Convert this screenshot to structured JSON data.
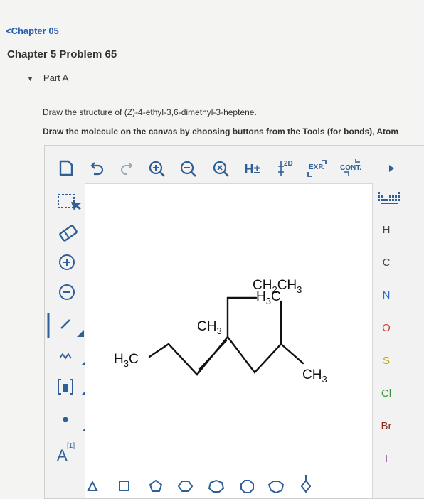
{
  "nav": {
    "back_label": "Chapter 05"
  },
  "problem": {
    "title": "Chapter 5 Problem 65",
    "part_label": "Part A"
  },
  "instructions": {
    "line1": "Draw the structure of (Z)-4-ethyl-3,6-dimethyl-3-heptene.",
    "line2": "Draw the molecule on the canvas by choosing buttons from the Tools (for bonds), Atom"
  },
  "toolbar": {
    "h_toggle": "H±",
    "twod_label": "2D",
    "exp_label": "EXP.",
    "cont_label": "CONT."
  },
  "left_tools": {
    "atom_prop_label": "A",
    "atom_prop_sup": "[1]"
  },
  "atoms": [
    "H",
    "C",
    "N",
    "O",
    "S",
    "Cl",
    "Br",
    "I"
  ],
  "atom_colors": {
    "H": "#444444",
    "C": "#444444",
    "N": "#2f6fbf",
    "O": "#d33b2f",
    "S": "#c9a100",
    "Cl": "#3a9a3a",
    "Br": "#8a2a1a",
    "I": "#8a2aa0"
  },
  "molecule": {
    "label_ch2ch3": "CH2CH3",
    "label_h3c_top": "H3C",
    "label_ch3_mid": "CH3",
    "label_h3c_left": "H3C",
    "label_ch3_right": "CH3"
  },
  "colors": {
    "accent": "#2f5f97",
    "link": "#2b5db0",
    "ring": "#2f5f97"
  }
}
